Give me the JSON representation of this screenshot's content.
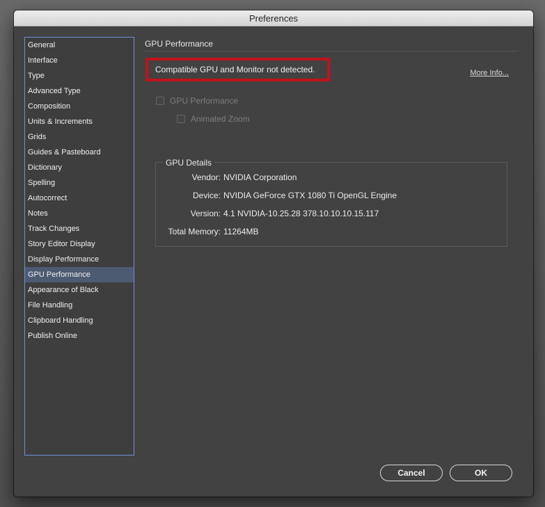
{
  "window": {
    "title": "Preferences"
  },
  "sidebar": {
    "items": [
      {
        "label": "General"
      },
      {
        "label": "Interface"
      },
      {
        "label": "Type"
      },
      {
        "label": "Advanced Type"
      },
      {
        "label": "Composition"
      },
      {
        "label": "Units & Increments"
      },
      {
        "label": "Grids"
      },
      {
        "label": "Guides & Pasteboard"
      },
      {
        "label": "Dictionary"
      },
      {
        "label": "Spelling"
      },
      {
        "label": "Autocorrect"
      },
      {
        "label": "Notes"
      },
      {
        "label": "Track Changes"
      },
      {
        "label": "Story Editor Display"
      },
      {
        "label": "Display Performance"
      },
      {
        "label": "GPU Performance"
      },
      {
        "label": "Appearance of Black"
      },
      {
        "label": "File Handling"
      },
      {
        "label": "Clipboard Handling"
      },
      {
        "label": "Publish Online"
      }
    ],
    "selected_label": "GPU Performance"
  },
  "content": {
    "section_title": "GPU Performance",
    "warning_text": "Compatible GPU and Monitor not detected.",
    "more_info_link": "More Info...",
    "gpu_performance_checkbox": {
      "label": "GPU Performance",
      "checked": false,
      "disabled": true
    },
    "animated_zoom_checkbox": {
      "label": "Animated Zoom",
      "checked": false,
      "disabled": true
    },
    "gpu_details": {
      "title": "GPU Details",
      "vendor_label": "Vendor:",
      "vendor_value": "NVIDIA Corporation",
      "device_label": "Device:",
      "device_value": "NVIDIA GeForce GTX 1080 Ti OpenGL Engine",
      "version_label": "Version:",
      "version_value": "4.1 NVIDIA-10.25.28 378.10.10.10.15.117",
      "memory_label": "Total Memory:",
      "memory_value": "11264MB"
    }
  },
  "buttons": {
    "cancel_label": "Cancel",
    "ok_label": "OK"
  },
  "colors": {
    "warning_border": "#c1121c",
    "selection_bg": "#4d5b72",
    "sidebar_border": "#6e8fd6"
  }
}
